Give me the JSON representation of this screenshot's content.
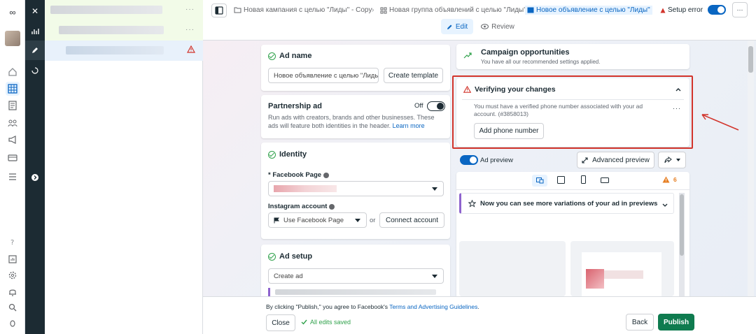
{
  "nav": {
    "logo": "∞",
    "close": "✕"
  },
  "breadcrumbs": {
    "campaign": "Новая кампания с целью \"Лиды\" - Copy",
    "adset": "Новая группа объявлений с целью \"Лиды\"",
    "ad": "Новое объявление с целью \"Лиды\""
  },
  "status": {
    "setup_error": "Setup error",
    "more": "···"
  },
  "tabs": {
    "edit": "Edit",
    "review": "Review"
  },
  "ad_name": {
    "title": "Ad name",
    "value": "Новое объявление с целью \"Лиды",
    "create_template": "Create template"
  },
  "partnership": {
    "title": "Partnership ad",
    "toggle_state": "Off",
    "description": "Run ads with creators, brands and other businesses. These ads will feature both identities in the header.",
    "learn_more": "Learn more"
  },
  "identity": {
    "title": "Identity",
    "facebook_page_label": "* Facebook Page",
    "instagram_label": "Instagram account",
    "instagram_value": "Use Facebook Page",
    "or": "or",
    "connect": "Connect account"
  },
  "ad_setup": {
    "title": "Ad setup",
    "value": "Create ad"
  },
  "opportunities": {
    "title": "Campaign opportunities",
    "subtitle": "You have all our recommended settings applied."
  },
  "verify": {
    "title": "Verifying your changes",
    "message": "You must have a verified phone number associated with your ad account. (#3858013)",
    "button": "Add phone number",
    "more": "···"
  },
  "preview": {
    "toggle_label": "Ad preview",
    "advanced": "Advanced preview",
    "warning_count": "6",
    "variations_text": "Now you can see more variations of your ad in previews"
  },
  "footer": {
    "terms_prefix": "By clicking \"Publish,\" you agree to Facebook's",
    "terms_link": "Terms and Advertising Guidelines",
    "terms_suffix": ".",
    "close": "Close",
    "saved": "All edits saved",
    "back": "Back",
    "publish": "Publish"
  },
  "colors": {
    "accent": "#0a66c2",
    "publish": "#0f7b4f",
    "error": "#d2342b",
    "success": "#31a24c"
  }
}
